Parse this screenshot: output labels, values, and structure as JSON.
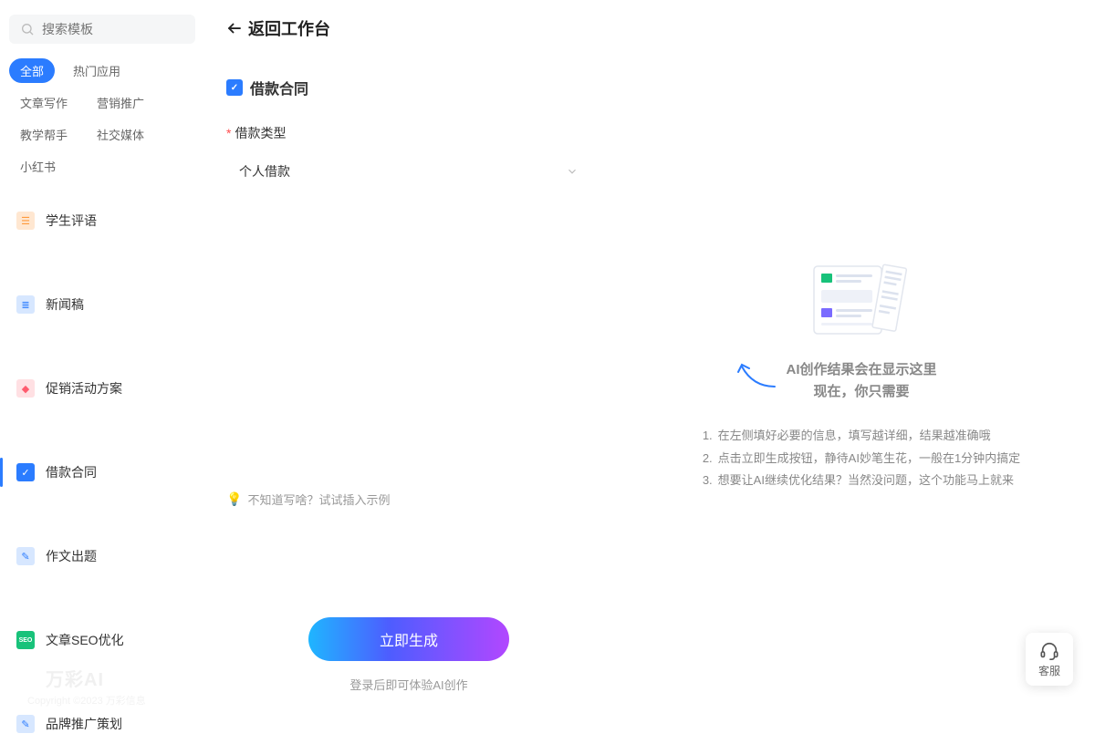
{
  "sidebar": {
    "search_placeholder": "搜索模板",
    "tags": [
      "全部",
      "热门应用",
      "文章写作",
      "营销推广",
      "教学帮手",
      "社交媒体",
      "小红书"
    ],
    "items": [
      {
        "label": "学生评语",
        "icon_bg": "#ff9a3c",
        "icon_glyph": "📝"
      },
      {
        "label": "新闻稿",
        "icon_bg": "#2b7cff",
        "icon_glyph": "📰"
      },
      {
        "label": "促销活动方案",
        "icon_bg": "#ff5b6e",
        "icon_glyph": "🏷"
      },
      {
        "label": "借款合同",
        "icon_bg": "#2b7cff",
        "icon_glyph": "📄"
      },
      {
        "label": "作文出题",
        "icon_bg": "#2b7cff",
        "icon_glyph": "✎"
      },
      {
        "label": "文章SEO优化",
        "icon_bg": "#18c27a",
        "icon_glyph": "SEO"
      },
      {
        "label": "品牌推广策划",
        "icon_bg": "#2b7cff",
        "icon_glyph": "📣"
      }
    ]
  },
  "main": {
    "back_label": "返回工作台",
    "form": {
      "title": "借款合同",
      "field_label": "借款类型",
      "required_mark": "*",
      "select_value": "个人借款",
      "helper_text": "不知道写啥？试试插入示例"
    },
    "generate_label": "立即生成",
    "login_hint": "登录后即可体验AI创作"
  },
  "result": {
    "headline_1": "AI创作结果会在显示这里",
    "headline_2": "现在，你只需要",
    "steps": [
      "在左侧填好必要的信息，填写越详细，结果越准确哦",
      "点击立即生成按钮，静待AI妙笔生花，一般在1分钟内搞定",
      "想要让AI继续优化结果？当然没问题，这个功能马上就来"
    ]
  },
  "float": {
    "cs_label": "客服"
  },
  "footer": {
    "watermark": "万彩AI",
    "copyright": "Copyright ©2023 万彩信息"
  }
}
